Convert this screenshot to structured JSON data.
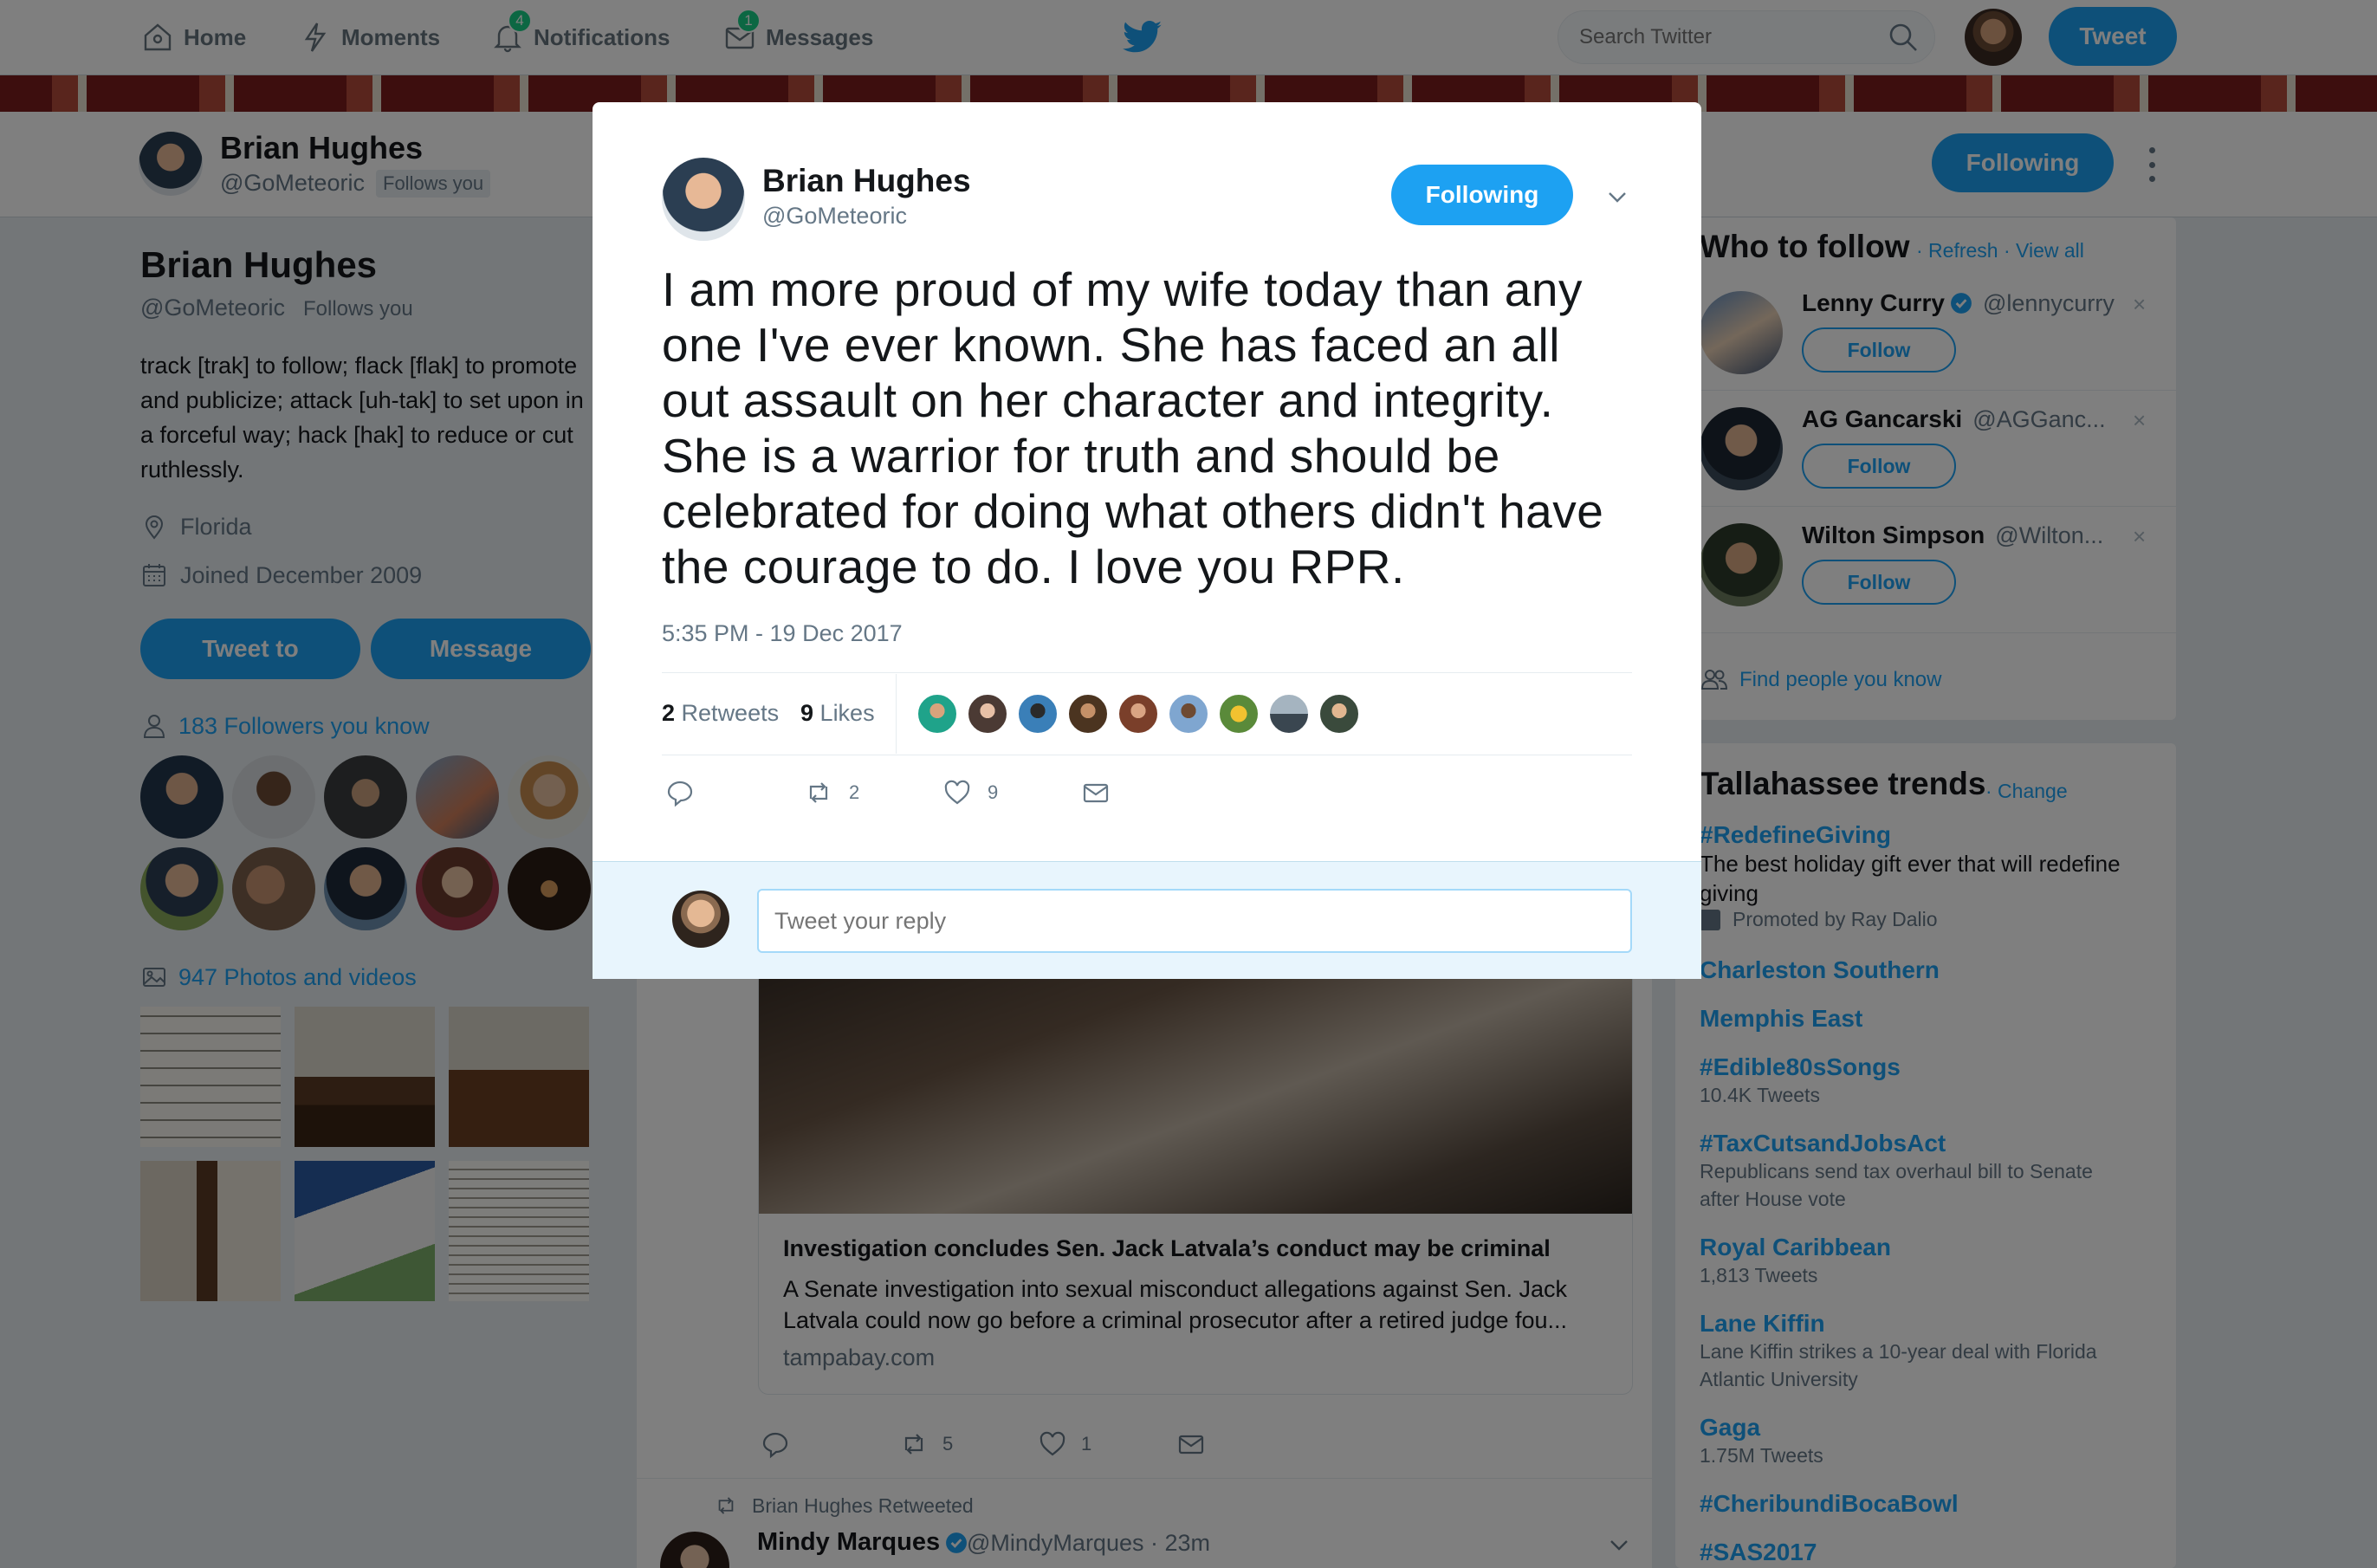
{
  "nav": {
    "home": "Home",
    "moments": "Moments",
    "notifications": "Notifications",
    "notifications_badge": "4",
    "messages": "Messages",
    "messages_badge": "1",
    "search_placeholder": "Search Twitter",
    "tweet_button": "Tweet"
  },
  "profile_bar": {
    "name": "Brian Hughes",
    "handle": "@GoMeteoric",
    "follows_you": "Follows you",
    "following_button": "Following"
  },
  "profile": {
    "name": "Brian Hughes",
    "handle": "@GoMeteoric",
    "follows_you": "Follows you",
    "bio": "track [trak] to follow; flack [flak] to promote and publicize; attack [uh-tak] to set upon in a forceful way; hack [hak] to reduce or cut ruthlessly.",
    "location": "Florida",
    "joined": "Joined December 2009",
    "tweet_to_button": "Tweet to",
    "message_button": "Message",
    "followers_you_know": "183 Followers you know",
    "photos_videos": "947 Photos and videos"
  },
  "modal": {
    "name": "Brian Hughes",
    "handle": "@GoMeteoric",
    "following_button": "Following",
    "text": "I am more proud of my wife today than any one I've ever known. She has faced an all out assault on her character and integrity. She is a warrior for truth and should be celebrated for doing what others didn't have the courage to do. I love you RPR.",
    "timestamp": "5:35 PM - 19 Dec 2017",
    "retweets_count": "2",
    "retweets_label": "Retweets",
    "likes_count": "9",
    "likes_label": "Likes",
    "action_retweet_count": "2",
    "action_like_count": "9",
    "reply_placeholder": "Tweet your reply"
  },
  "timeline_card": {
    "title": "Investigation concludes Sen. Jack Latvala’s conduct may be criminal",
    "description": "A Senate investigation into sexual misconduct allegations against Sen. Jack Latvala could now go before a criminal prosecutor after a retired judge fou...",
    "url": "tampabay.com",
    "retweet_count": "5",
    "like_count": "1"
  },
  "next_tweet": {
    "retweeted_by": "Brian Hughes Retweeted",
    "name": "Mindy Marques",
    "handle": "@MindyMarques · 23m"
  },
  "who_to_follow": {
    "title": "Who to follow",
    "refresh": "· Refresh",
    "view_all": "· View all",
    "follow_label": "Follow",
    "close_glyph": "×",
    "users": [
      {
        "name": "Lenny Curry",
        "handle": "@lennycurry",
        "verified": true
      },
      {
        "name": "AG Gancarski",
        "handle": "@AGGanc...",
        "verified": false
      },
      {
        "name": "Wilton Simpson",
        "handle": "@Wilton...",
        "verified": false
      }
    ],
    "find_people": "Find people you know"
  },
  "trends": {
    "title": "Tallahassee trends",
    "change": "· Change",
    "items": [
      {
        "name": "#RedefineGiving",
        "desc": "The best holiday gift ever that will redefine giving",
        "promoted": "Promoted by Ray Dalio"
      },
      {
        "name": "Charleston Southern"
      },
      {
        "name": "Memphis East"
      },
      {
        "name": "#Edible80sSongs",
        "sub": "10.4K Tweets"
      },
      {
        "name": "#TaxCutsandJobsAct",
        "sub": "Republicans send tax overhaul bill to Senate after House vote"
      },
      {
        "name": "Royal Caribbean",
        "sub": "1,813 Tweets"
      },
      {
        "name": "Lane Kiffin",
        "sub": "Lane Kiffin strikes a 10-year deal with Florida Atlantic University"
      },
      {
        "name": "Gaga",
        "sub": "1.75M Tweets"
      },
      {
        "name": "#CheribundiBocaBowl"
      },
      {
        "name": "#SAS2017"
      }
    ]
  },
  "colors": {
    "accent": "#1da1f2",
    "overlay": "#000000"
  }
}
